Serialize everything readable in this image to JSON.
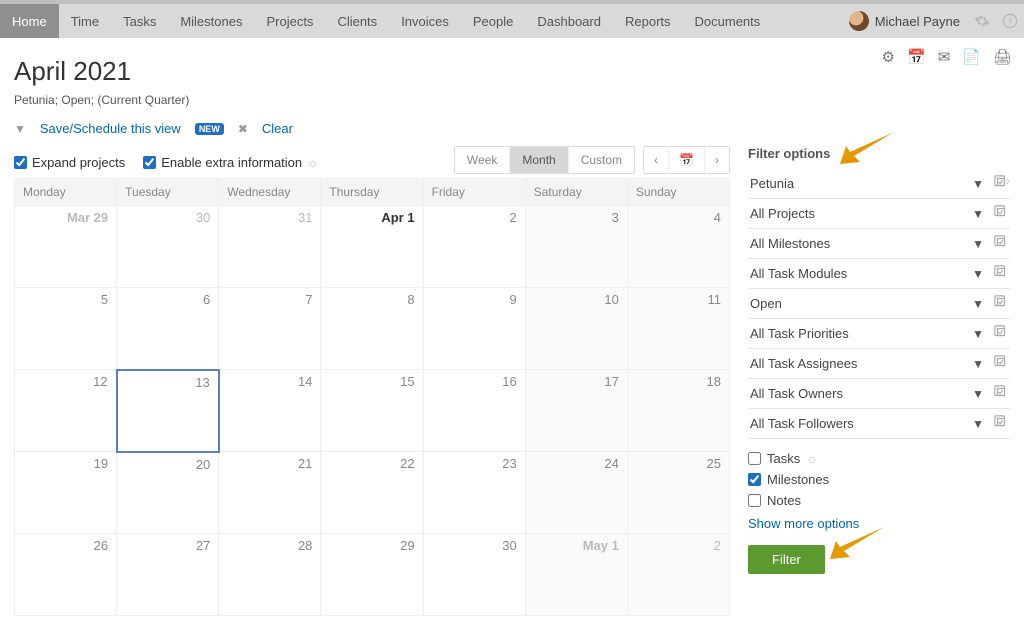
{
  "nav": {
    "items": [
      "Home",
      "Time",
      "Tasks",
      "Milestones",
      "Projects",
      "Clients",
      "Invoices",
      "People",
      "Dashboard",
      "Reports",
      "Documents"
    ],
    "active": "Home",
    "user": "Michael Payne"
  },
  "page": {
    "title": "April 2021",
    "subtitle": "Petunia; Open; (Current Quarter)",
    "save_view": "Save/Schedule this view",
    "new_badge": "NEW",
    "clear": "Clear",
    "expand_projects": "Expand projects",
    "enable_extra": "Enable extra information"
  },
  "cal_controls": {
    "week": "Week",
    "month": "Month",
    "custom": "Custom"
  },
  "calendar": {
    "headers": [
      "Monday",
      "Tuesday",
      "Wednesday",
      "Thursday",
      "Friday",
      "Saturday",
      "Sunday"
    ],
    "weeks": [
      [
        {
          "t": "Mar 29",
          "cls": "out month-lead"
        },
        {
          "t": "30",
          "cls": "out"
        },
        {
          "t": "31",
          "cls": "out"
        },
        {
          "t": "Apr 1",
          "cls": "first"
        },
        {
          "t": "2",
          "cls": ""
        },
        {
          "t": "3",
          "cls": "weekend"
        },
        {
          "t": "4",
          "cls": "weekend"
        }
      ],
      [
        {
          "t": "5",
          "cls": ""
        },
        {
          "t": "6",
          "cls": ""
        },
        {
          "t": "7",
          "cls": ""
        },
        {
          "t": "8",
          "cls": ""
        },
        {
          "t": "9",
          "cls": ""
        },
        {
          "t": "10",
          "cls": "weekend"
        },
        {
          "t": "11",
          "cls": "weekend"
        }
      ],
      [
        {
          "t": "12",
          "cls": ""
        },
        {
          "t": "13",
          "cls": "today"
        },
        {
          "t": "14",
          "cls": ""
        },
        {
          "t": "15",
          "cls": ""
        },
        {
          "t": "16",
          "cls": ""
        },
        {
          "t": "17",
          "cls": "weekend"
        },
        {
          "t": "18",
          "cls": "weekend"
        }
      ],
      [
        {
          "t": "19",
          "cls": ""
        },
        {
          "t": "20",
          "cls": ""
        },
        {
          "t": "21",
          "cls": ""
        },
        {
          "t": "22",
          "cls": ""
        },
        {
          "t": "23",
          "cls": ""
        },
        {
          "t": "24",
          "cls": "weekend"
        },
        {
          "t": "25",
          "cls": "weekend"
        }
      ],
      [
        {
          "t": "26",
          "cls": ""
        },
        {
          "t": "27",
          "cls": ""
        },
        {
          "t": "28",
          "cls": ""
        },
        {
          "t": "29",
          "cls": ""
        },
        {
          "t": "30",
          "cls": ""
        },
        {
          "t": "May 1",
          "cls": "out weekend month-lead"
        },
        {
          "t": "2",
          "cls": "out weekend"
        }
      ]
    ]
  },
  "filters": {
    "title": "Filter options",
    "rows": [
      "Petunia",
      "All Projects",
      "All Milestones",
      "All Task Modules",
      "Open",
      "All Task Priorities",
      "All Task Assignees",
      "All Task Owners",
      "All Task Followers"
    ],
    "checks": {
      "tasks": "Tasks",
      "milestones": "Milestones",
      "notes": "Notes"
    },
    "more": "Show more options",
    "button": "Filter"
  }
}
